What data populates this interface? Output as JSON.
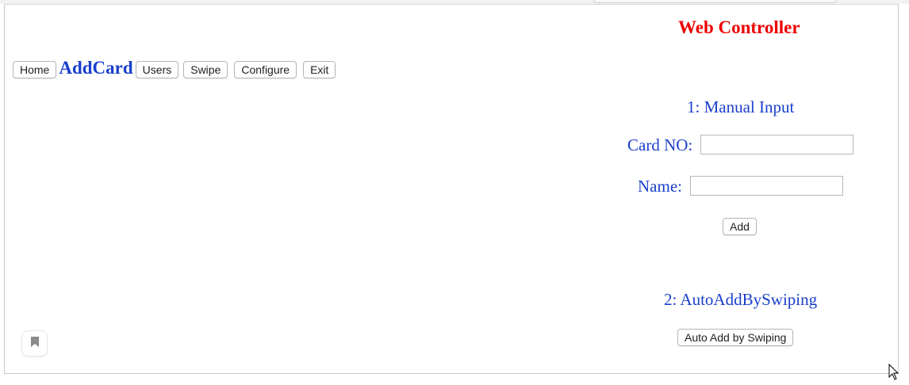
{
  "header": {
    "title": "Web Controller"
  },
  "nav": {
    "home_label": "Home",
    "current_label": "AddCard",
    "users_label": "Users",
    "swipe_label": "Swipe",
    "configure_label": "Configure",
    "exit_label": "Exit"
  },
  "manual_input": {
    "heading": "1: Manual Input",
    "card_no_label": "Card NO:",
    "card_no_value": "",
    "name_label": "Name:",
    "name_value": "",
    "add_button": "Add"
  },
  "auto_add": {
    "heading": "2: AutoAddBySwiping",
    "button": "Auto Add by Swiping"
  },
  "icons": {
    "bookmark": "bookmark-icon",
    "cursor": "mouse-pointer-icon"
  },
  "colors": {
    "title": "#ee0000",
    "accent_text": "#1a3fcc"
  }
}
